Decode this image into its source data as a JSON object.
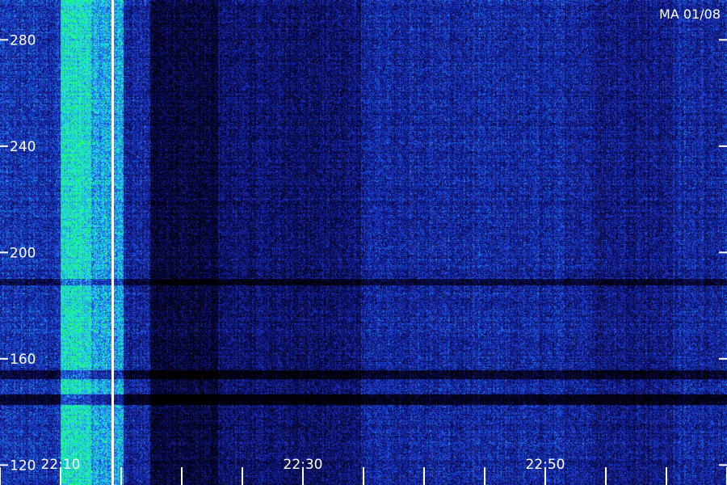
{
  "chart_data": {
    "type": "heatmap",
    "title": "",
    "xlabel": "",
    "ylabel": "",
    "station_label": "MA 01/08",
    "y_ticks": [
      {
        "value": 120,
        "label": "120"
      },
      {
        "value": 160,
        "label": "160"
      },
      {
        "value": 200,
        "label": "200"
      },
      {
        "value": 240,
        "label": "240"
      },
      {
        "value": 280,
        "label": "280"
      }
    ],
    "ylim": [
      112.5,
      295
    ],
    "x_major_ticks": [
      {
        "value": 10,
        "label": "22:10"
      },
      {
        "value": 30,
        "label": "22:30"
      },
      {
        "value": 50,
        "label": "22:50"
      }
    ],
    "x_minor_tick_every": 5,
    "xlim": [
      5,
      65
    ],
    "cursor_minute": 14.3,
    "colors": {
      "background": "#000000",
      "low": "#0a0a5a",
      "mid": "#2040e0",
      "high": "#20e0ff",
      "peak": "#20ff60",
      "axis": "#ffffff"
    },
    "intensity_bands": [
      {
        "minute_start": 5,
        "minute_end": 10,
        "level": 0.45
      },
      {
        "minute_start": 10,
        "minute_end": 12.5,
        "level": 0.85
      },
      {
        "minute_start": 12.5,
        "minute_end": 15.2,
        "level": 0.72
      },
      {
        "minute_start": 15.2,
        "minute_end": 17.4,
        "level": 0.4
      },
      {
        "minute_start": 17.4,
        "minute_end": 23,
        "level": 0.16
      },
      {
        "minute_start": 23,
        "minute_end": 34.8,
        "level": 0.28
      },
      {
        "minute_start": 34.8,
        "minute_end": 53.8,
        "level": 0.4
      },
      {
        "minute_start": 53.8,
        "minute_end": 60.5,
        "level": 0.34
      },
      {
        "minute_start": 60.5,
        "minute_end": 65,
        "level": 0.4
      }
    ]
  }
}
